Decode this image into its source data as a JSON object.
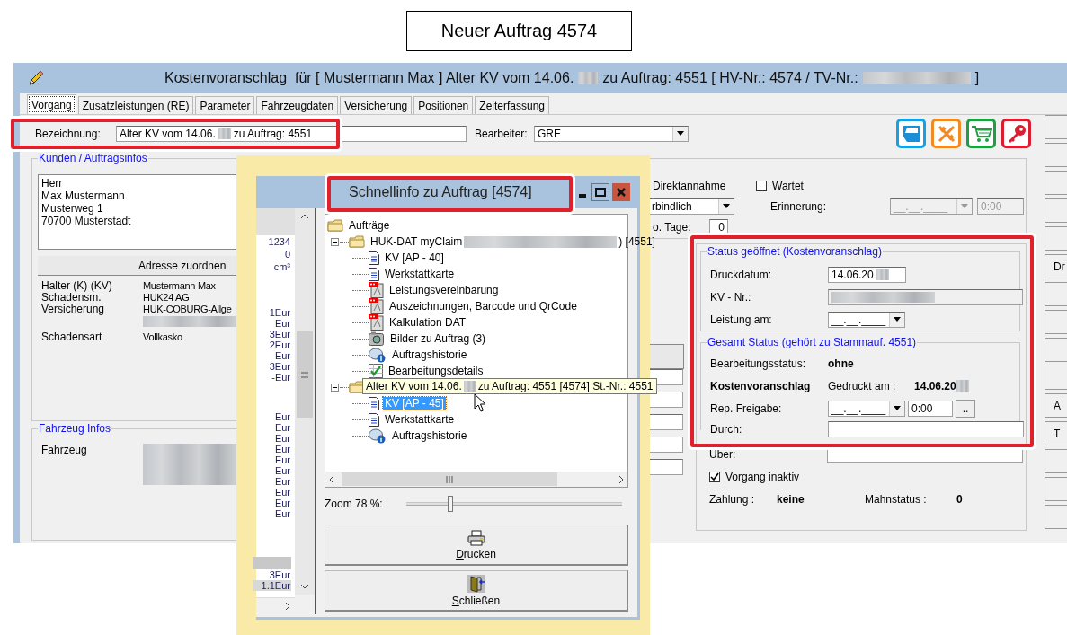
{
  "caption": "Neuer Auftrag 4574",
  "window": {
    "title_parts": [
      "Kostenvoranschlag  für [ Mustermann Max ] Alter KV vom 14.06.",
      "zu Auftrag: 4551 [ HV-Nr.: 4574 / TV-Nr.:",
      "]"
    ]
  },
  "tabs": [
    {
      "label": "Vorgang",
      "selected": true
    },
    {
      "label": "Zusatzleistungen (RE)",
      "selected": false
    },
    {
      "label": "Parameter",
      "selected": false
    },
    {
      "label": "Fahrzeugdaten",
      "selected": false
    },
    {
      "label": "Versicherung",
      "selected": false
    },
    {
      "label": "Positionen",
      "selected": false
    },
    {
      "label": "Zeiterfassung",
      "selected": false
    }
  ],
  "form": {
    "bezeichnung_label": "Bezeichnung:",
    "bezeichnung_parts": [
      "Alter KV vom 14.06.",
      "zu Auftrag: 4551"
    ],
    "bearbeiter_label": "Bearbeiter:",
    "bearbeiter_value": "GRE"
  },
  "customer": {
    "title": "Kunden / Auftragsinfos",
    "address": [
      "Herr",
      "Max Mustermann",
      "Musterweg 1",
      "70700 Musterstadt"
    ],
    "assign_button": "Adresse zuordnen",
    "info": [
      {
        "label": "Halter (K) (KV)",
        "value": "Mustermann Max",
        "blurred_line": false
      },
      {
        "label": "Schadensm.",
        "value": "HUK24 AG",
        "blurred_line": false
      },
      {
        "label": "Versicherung",
        "value": "HUK-COBURG-Allge",
        "blurred_line": true
      },
      {
        "label": "Schadensart",
        "value": "Vollkasko",
        "blurred_line": false
      }
    ]
  },
  "vehicle": {
    "title": "Fahrzeug Infos",
    "label": "Fahrzeug"
  },
  "planning": {
    "direktannahme": "Direktannahme",
    "wartet": {
      "label": "Wartet",
      "checked": false
    },
    "binding": "rbindlich",
    "erinnerung_label": "Erinnerung:",
    "erinnerung_date": {
      "value": "__.__.____",
      "disabled": true
    },
    "erinnerung_time": {
      "value": "0:00",
      "disabled": true
    },
    "tage_label": "o. Tage:",
    "tage_value": "0"
  },
  "status": {
    "title": "Status geöffnet (Kostenvoranschlag)",
    "druckdatum_label": "Druckdatum:",
    "druckdatum": "14.06.20",
    "kvnr_label": "KV - Nr.:",
    "leistung_label": "Leistung am:",
    "leistung": "__.__.____"
  },
  "gesamt": {
    "title": "Gesamt Status (gehört zu Stammauf. 4551)",
    "bearb_label": "Bearbeitungsstatus:",
    "bearb_value": "ohne",
    "kind_label": "Kostenvoranschlag",
    "gedruckt_label": "Gedruckt am :",
    "gedruckt_value": "14.06.20",
    "freigabe_label": "Rep. Freigabe:",
    "freigabe_date": "__.__.____",
    "freigabe_time": "0:00",
    "more": "..",
    "durch_label": "Durch:"
  },
  "bottom": {
    "ueber_label": "Über:",
    "inaktiv": {
      "label": "Vorgang inaktiv",
      "checked": true
    },
    "zahlung_label": "Zahlung :",
    "zahlung": "keine",
    "mahn_label": "Mahnstatus :",
    "mahn": "0"
  },
  "side_buttons": [
    {
      "kind": "blank"
    },
    {
      "kind": "blank"
    },
    {
      "kind": "blank"
    },
    {
      "kind": "blank"
    },
    {
      "kind": "blank"
    },
    {
      "kind": "text",
      "label": "Dr"
    },
    {
      "kind": "blank"
    },
    {
      "kind": "blank"
    },
    {
      "kind": "blank"
    },
    {
      "kind": "blank"
    },
    {
      "kind": "text",
      "label": "A"
    },
    {
      "kind": "text",
      "label": "T"
    },
    {
      "kind": "blank"
    },
    {
      "kind": "blank"
    },
    {
      "kind": "blank"
    }
  ],
  "popup": {
    "title": "Schnellinfo zu Auftrag [4574]",
    "value_groups": [
      [
        {
          "text": "1234",
          "selected": false
        },
        {
          "text": "0",
          "selected": false
        },
        {
          "text": "cm³",
          "selected": false
        }
      ],
      [
        {
          "text": "1Eur",
          "selected": false
        },
        {
          "text": "Eur",
          "selected": false
        },
        {
          "text": "3Eur",
          "selected": false
        },
        {
          "text": "2Eur",
          "selected": false
        },
        {
          "text": "Eur",
          "selected": false
        },
        {
          "text": "3Eur",
          "selected": false
        },
        {
          "text": "-Eur",
          "selected": false
        }
      ],
      [
        {
          "text": "Eur",
          "selected": false
        },
        {
          "text": "Eur",
          "selected": false
        },
        {
          "text": "Eur",
          "selected": false
        },
        {
          "text": "Eur",
          "selected": false
        },
        {
          "text": "Eur",
          "selected": false
        },
        {
          "text": "Eur",
          "selected": false
        },
        {
          "text": "Eur",
          "selected": false
        },
        {
          "text": "Eur",
          "selected": false
        },
        {
          "text": "Eur",
          "selected": false
        },
        {
          "text": "Eur",
          "selected": false
        }
      ],
      [
        {
          "text": "3Eur",
          "selected": false
        },
        {
          "text": "1.1Eur",
          "selected": true
        }
      ]
    ],
    "tree": [
      {
        "label": "Aufträge",
        "kind": "folder",
        "selected": false,
        "children": [
          {
            "label": "HUK-DAT myClaim",
            "label_end": ") [4551]",
            "kind": "folder",
            "selected": false,
            "expanded": true,
            "children": [
              {
                "label": "KV [AP - 40]",
                "kind": "doc",
                "selected": false
              },
              {
                "label": "Werkstattkarte",
                "kind": "doc",
                "selected": false
              },
              {
                "label": "Leistungsvereinbarung",
                "kind": "pdf",
                "selected": false
              },
              {
                "label": "Auszeichnungen, Barcode und QrCode",
                "kind": "pdf",
                "selected": false
              },
              {
                "label": "Kalkulation DAT",
                "kind": "pdf",
                "selected": false
              },
              {
                "label": "Bilder zu Auftrag (3)",
                "kind": "photos",
                "selected": false
              },
              {
                "label": "Auftragshistorie",
                "kind": "info",
                "selected": false
              },
              {
                "label": "Bearbeitungsdetails",
                "kind": "check",
                "selected": false
              }
            ]
          },
          {
            "kind": "folder",
            "selected": false,
            "expanded": true,
            "children": [
              {
                "label": "KV [AP - 45]",
                "kind": "doc",
                "selected": true
              },
              {
                "label": "Werkstattkarte",
                "kind": "doc",
                "selected": false
              },
              {
                "label": "Auftragshistorie",
                "kind": "info",
                "selected": false
              }
            ]
          }
        ]
      }
    ],
    "tooltip_parts": [
      "Alter KV vom 14.06.",
      "zu Auftrag: 4551 [4574] St.-Nr.: 4551"
    ],
    "zoom_label": "Zoom 78 %:",
    "zoom": {
      "level": 0.2
    },
    "print": "Drucken",
    "close": "Schließen"
  }
}
